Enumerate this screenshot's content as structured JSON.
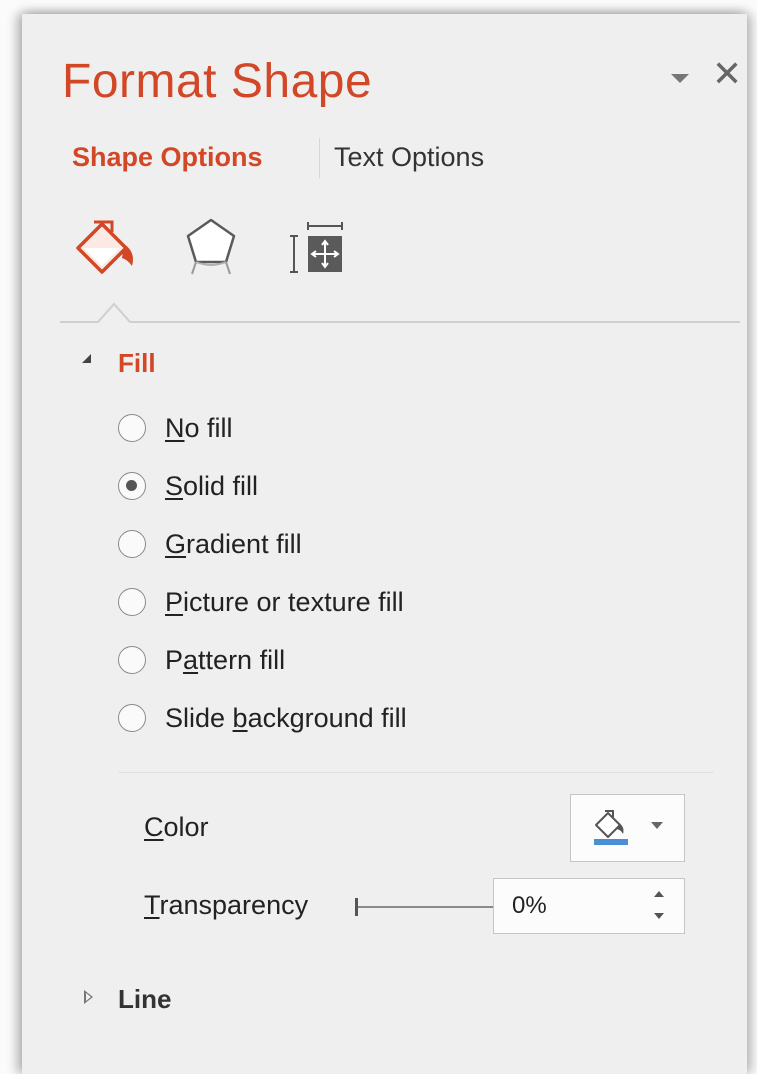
{
  "pane": {
    "title": "Format Shape",
    "dropdown_icon": "chevron-down-icon",
    "close_icon": "close-icon",
    "accent_color": "#d24726"
  },
  "tabs": [
    {
      "label": "Shape Options",
      "active": true
    },
    {
      "label": "Text Options",
      "active": false
    }
  ],
  "category_icons": [
    {
      "name": "fill-line-icon",
      "active": true
    },
    {
      "name": "effects-icon",
      "active": false
    },
    {
      "name": "size-properties-icon",
      "active": false
    }
  ],
  "fill": {
    "label": "Fill",
    "expanded": true,
    "options": [
      {
        "pre": "",
        "key": "N",
        "post": "o fill",
        "selected": false
      },
      {
        "pre": "",
        "key": "S",
        "post": "olid fill",
        "selected": true
      },
      {
        "pre": "",
        "key": "G",
        "post": "radient fill",
        "selected": false
      },
      {
        "pre": "",
        "key": "P",
        "post": "icture or texture fill",
        "selected": false
      },
      {
        "pre": "P",
        "key": "a",
        "post": "ttern fill",
        "selected": false
      },
      {
        "pre": "Slide ",
        "key": "b",
        "post": "ackground fill",
        "selected": false
      }
    ],
    "color": {
      "label_key": "C",
      "label_rest": "olor",
      "icon": "paint-bucket-icon",
      "swatch_color": "#4a8fd6"
    },
    "transparency": {
      "label_key": "T",
      "label_rest": "ransparency",
      "value": "0%"
    }
  },
  "line": {
    "label": "Line",
    "expanded": false
  }
}
